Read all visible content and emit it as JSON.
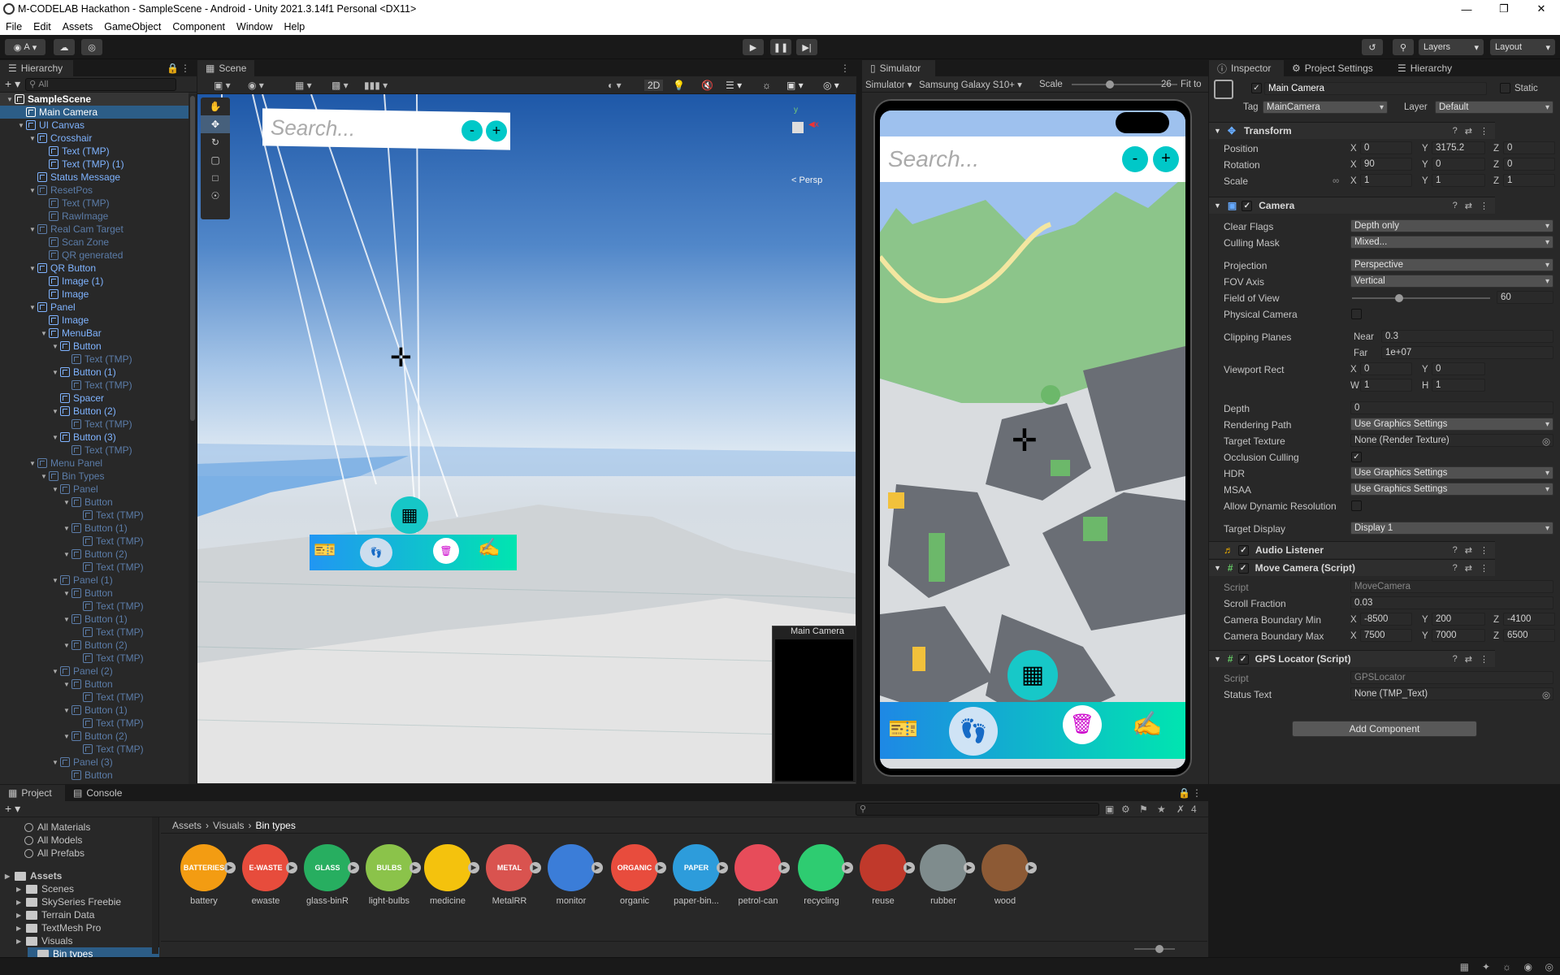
{
  "window": {
    "title": "M-CODELAB Hackathon - SampleScene - Android - Unity 2021.3.14f1 Personal <DX11>"
  },
  "menu": [
    "File",
    "Edit",
    "Assets",
    "GameObject",
    "Component",
    "Window",
    "Help"
  ],
  "toolbar": {
    "account": "A",
    "layers": "Layers",
    "layout": "Layout"
  },
  "hierarchy": {
    "tab": "Hierarchy",
    "search_placeholder": "All",
    "items": [
      {
        "label": "SampleScene",
        "depth": 0,
        "kind": "scene"
      },
      {
        "label": "Main Camera",
        "depth": 1,
        "kind": "sel"
      },
      {
        "label": "UI Canvas",
        "depth": 1,
        "kind": "ui"
      },
      {
        "label": "Crosshair",
        "depth": 2,
        "kind": "ui"
      },
      {
        "label": "Text (TMP)",
        "depth": 3,
        "kind": "ui"
      },
      {
        "label": "Text (TMP) (1)",
        "depth": 3,
        "kind": "ui"
      },
      {
        "label": "Status Message",
        "depth": 2,
        "kind": "ui"
      },
      {
        "label": "ResetPos",
        "depth": 2,
        "kind": "dim"
      },
      {
        "label": "Text (TMP)",
        "depth": 3,
        "kind": "dim"
      },
      {
        "label": "RawImage",
        "depth": 3,
        "kind": "dim"
      },
      {
        "label": "Real Cam Target",
        "depth": 2,
        "kind": "dim"
      },
      {
        "label": "Scan Zone",
        "depth": 3,
        "kind": "dim"
      },
      {
        "label": "QR generated",
        "depth": 3,
        "kind": "dim"
      },
      {
        "label": "QR Button",
        "depth": 2,
        "kind": "ui"
      },
      {
        "label": "Image (1)",
        "depth": 3,
        "kind": "ui"
      },
      {
        "label": "Image",
        "depth": 3,
        "kind": "ui"
      },
      {
        "label": "Panel",
        "depth": 2,
        "kind": "ui"
      },
      {
        "label": "Image",
        "depth": 3,
        "kind": "ui"
      },
      {
        "label": "MenuBar",
        "depth": 3,
        "kind": "ui"
      },
      {
        "label": "Button",
        "depth": 4,
        "kind": "ui"
      },
      {
        "label": "Text (TMP)",
        "depth": 5,
        "kind": "dim"
      },
      {
        "label": "Button (1)",
        "depth": 4,
        "kind": "ui"
      },
      {
        "label": "Text (TMP)",
        "depth": 5,
        "kind": "dim"
      },
      {
        "label": "Spacer",
        "depth": 4,
        "kind": "ui"
      },
      {
        "label": "Button (2)",
        "depth": 4,
        "kind": "ui"
      },
      {
        "label": "Text (TMP)",
        "depth": 5,
        "kind": "dim"
      },
      {
        "label": "Button (3)",
        "depth": 4,
        "kind": "ui"
      },
      {
        "label": "Text (TMP)",
        "depth": 5,
        "kind": "dim"
      },
      {
        "label": "Menu Panel",
        "depth": 2,
        "kind": "dim"
      },
      {
        "label": "Bin Types",
        "depth": 3,
        "kind": "dim"
      },
      {
        "label": "Panel",
        "depth": 4,
        "kind": "dim"
      },
      {
        "label": "Button",
        "depth": 5,
        "kind": "dim"
      },
      {
        "label": "Text (TMP)",
        "depth": 6,
        "kind": "dim"
      },
      {
        "label": "Button (1)",
        "depth": 5,
        "kind": "dim"
      },
      {
        "label": "Text (TMP)",
        "depth": 6,
        "kind": "dim"
      },
      {
        "label": "Button (2)",
        "depth": 5,
        "kind": "dim"
      },
      {
        "label": "Text (TMP)",
        "depth": 6,
        "kind": "dim"
      },
      {
        "label": "Panel (1)",
        "depth": 4,
        "kind": "dim"
      },
      {
        "label": "Button",
        "depth": 5,
        "kind": "dim"
      },
      {
        "label": "Text (TMP)",
        "depth": 6,
        "kind": "dim"
      },
      {
        "label": "Button (1)",
        "depth": 5,
        "kind": "dim"
      },
      {
        "label": "Text (TMP)",
        "depth": 6,
        "kind": "dim"
      },
      {
        "label": "Button (2)",
        "depth": 5,
        "kind": "dim"
      },
      {
        "label": "Text (TMP)",
        "depth": 6,
        "kind": "dim"
      },
      {
        "label": "Panel (2)",
        "depth": 4,
        "kind": "dim"
      },
      {
        "label": "Button",
        "depth": 5,
        "kind": "dim"
      },
      {
        "label": "Text (TMP)",
        "depth": 6,
        "kind": "dim"
      },
      {
        "label": "Button (1)",
        "depth": 5,
        "kind": "dim"
      },
      {
        "label": "Text (TMP)",
        "depth": 6,
        "kind": "dim"
      },
      {
        "label": "Button (2)",
        "depth": 5,
        "kind": "dim"
      },
      {
        "label": "Text (TMP)",
        "depth": 6,
        "kind": "dim"
      },
      {
        "label": "Panel (3)",
        "depth": 4,
        "kind": "dim"
      },
      {
        "label": "Button",
        "depth": 5,
        "kind": "dim"
      }
    ]
  },
  "scene": {
    "tab": "Scene",
    "mode_2d": "2D",
    "persp": "< Persp",
    "search_placeholder": "Search...",
    "minus": "-",
    "plus": "+",
    "camera_preview_title": "Main Camera"
  },
  "simulator": {
    "tab": "Simulator",
    "mode": "Simulator",
    "device": "Samsung Galaxy S10+",
    "scale_label": "Scale",
    "scale_value": "26",
    "scale_fraction": 0.35,
    "fit": "Fit to",
    "search_placeholder": "Search...",
    "minus": "-",
    "plus": "+"
  },
  "inspector": {
    "tabs": [
      "Inspector",
      "Project Settings",
      "Hierarchy"
    ],
    "object_name": "Main Camera",
    "static_label": "Static",
    "tag_label": "Tag",
    "tag_value": "MainCamera",
    "layer_label": "Layer",
    "layer_value": "Default",
    "transform": {
      "title": "Transform",
      "position": {
        "label": "Position",
        "x": "0",
        "y": "3175.2",
        "z": "0"
      },
      "rotation": {
        "label": "Rotation",
        "x": "90",
        "y": "0",
        "z": "0"
      },
      "scale": {
        "label": "Scale",
        "x": "1",
        "y": "1",
        "z": "1"
      }
    },
    "camera": {
      "title": "Camera",
      "clear_flags": {
        "label": "Clear Flags",
        "value": "Depth only"
      },
      "culling_mask": {
        "label": "Culling Mask",
        "value": "Mixed..."
      },
      "projection": {
        "label": "Projection",
        "value": "Perspective"
      },
      "fov_axis": {
        "label": "FOV Axis",
        "value": "Vertical"
      },
      "fov": {
        "label": "Field of View",
        "value": "60",
        "fraction": 0.33
      },
      "physical": {
        "label": "Physical Camera"
      },
      "clipping": {
        "label": "Clipping Planes",
        "near_label": "Near",
        "near": "0.3",
        "far_label": "Far",
        "far": "1e+07"
      },
      "viewport": {
        "label": "Viewport Rect",
        "x": "0",
        "y": "0",
        "w": "1",
        "h": "1"
      },
      "depth": {
        "label": "Depth",
        "value": "0"
      },
      "rendering_path": {
        "label": "Rendering Path",
        "value": "Use Graphics Settings"
      },
      "target_texture": {
        "label": "Target Texture",
        "value": "None (Render Texture)"
      },
      "occlusion": {
        "label": "Occlusion Culling"
      },
      "hdr": {
        "label": "HDR",
        "value": "Use Graphics Settings"
      },
      "msaa": {
        "label": "MSAA",
        "value": "Use Graphics Settings"
      },
      "dyn_res": {
        "label": "Allow Dynamic Resolution"
      },
      "target_display": {
        "label": "Target Display",
        "value": "Display 1"
      }
    },
    "audio_listener": {
      "title": "Audio Listener"
    },
    "move_camera": {
      "title": "Move Camera (Script)",
      "script_label": "Script",
      "script_value": "MoveCamera",
      "scroll_label": "Scroll Fraction",
      "scroll_value": "0.03",
      "min_label": "Camera Boundary Min",
      "min_x": "-8500",
      "min_y": "200",
      "min_z": "-4100",
      "max_label": "Camera Boundary Max",
      "max_x": "7500",
      "max_y": "7000",
      "max_z": "6500"
    },
    "gps": {
      "title": "GPS Locator (Script)",
      "script_label": "Script",
      "script_value": "GPSLocator",
      "status_label": "Status Text",
      "status_value": "None (TMP_Text)"
    },
    "add_component": "Add Component"
  },
  "project": {
    "tabs": [
      "Project",
      "Console"
    ],
    "breadcrumb": [
      "Assets",
      "Visuals",
      "Bin types"
    ],
    "hidden_count": "4",
    "favorites": [
      "All Materials",
      "All Models",
      "All Prefabs"
    ],
    "tree": [
      {
        "label": "Assets",
        "depth": 0,
        "bold": true
      },
      {
        "label": "Scenes",
        "depth": 1
      },
      {
        "label": "SkySeries Freebie",
        "depth": 1
      },
      {
        "label": "Terrain Data",
        "depth": 1
      },
      {
        "label": "TextMesh Pro",
        "depth": 1
      },
      {
        "label": "Visuals",
        "depth": 1
      },
      {
        "label": "Bin types",
        "depth": 2,
        "selected": true
      }
    ],
    "assets": [
      {
        "name": "battery",
        "badge": "BATTERIES",
        "color": "#f39c12"
      },
      {
        "name": "ewaste",
        "badge": "E-WASTE",
        "color": "#e74c3c"
      },
      {
        "name": "glass-binR",
        "badge": "GLASS",
        "color": "#27ae60"
      },
      {
        "name": "light-bulbs",
        "badge": "BULBS",
        "color": "#8bc34a"
      },
      {
        "name": "medicine",
        "badge": "",
        "color": "#f4c20d"
      },
      {
        "name": "MetalRR",
        "badge": "METAL",
        "color": "#d9534f"
      },
      {
        "name": "monitor",
        "badge": "",
        "color": "#3b7dd8"
      },
      {
        "name": "organic",
        "badge": "ORGANIC",
        "color": "#e84c3d"
      },
      {
        "name": "paper-bin...",
        "badge": "PAPER",
        "color": "#2d9cdb"
      },
      {
        "name": "petrol-can",
        "badge": "",
        "color": "#e74c5a"
      },
      {
        "name": "recycling",
        "badge": "",
        "color": "#2ecc71"
      },
      {
        "name": "reuse",
        "badge": "",
        "color": "#c0392b"
      },
      {
        "name": "rubber",
        "badge": "",
        "color": "#7f8c8d"
      },
      {
        "name": "wood",
        "badge": "",
        "color": "#8d5a35"
      }
    ]
  },
  "status": {}
}
